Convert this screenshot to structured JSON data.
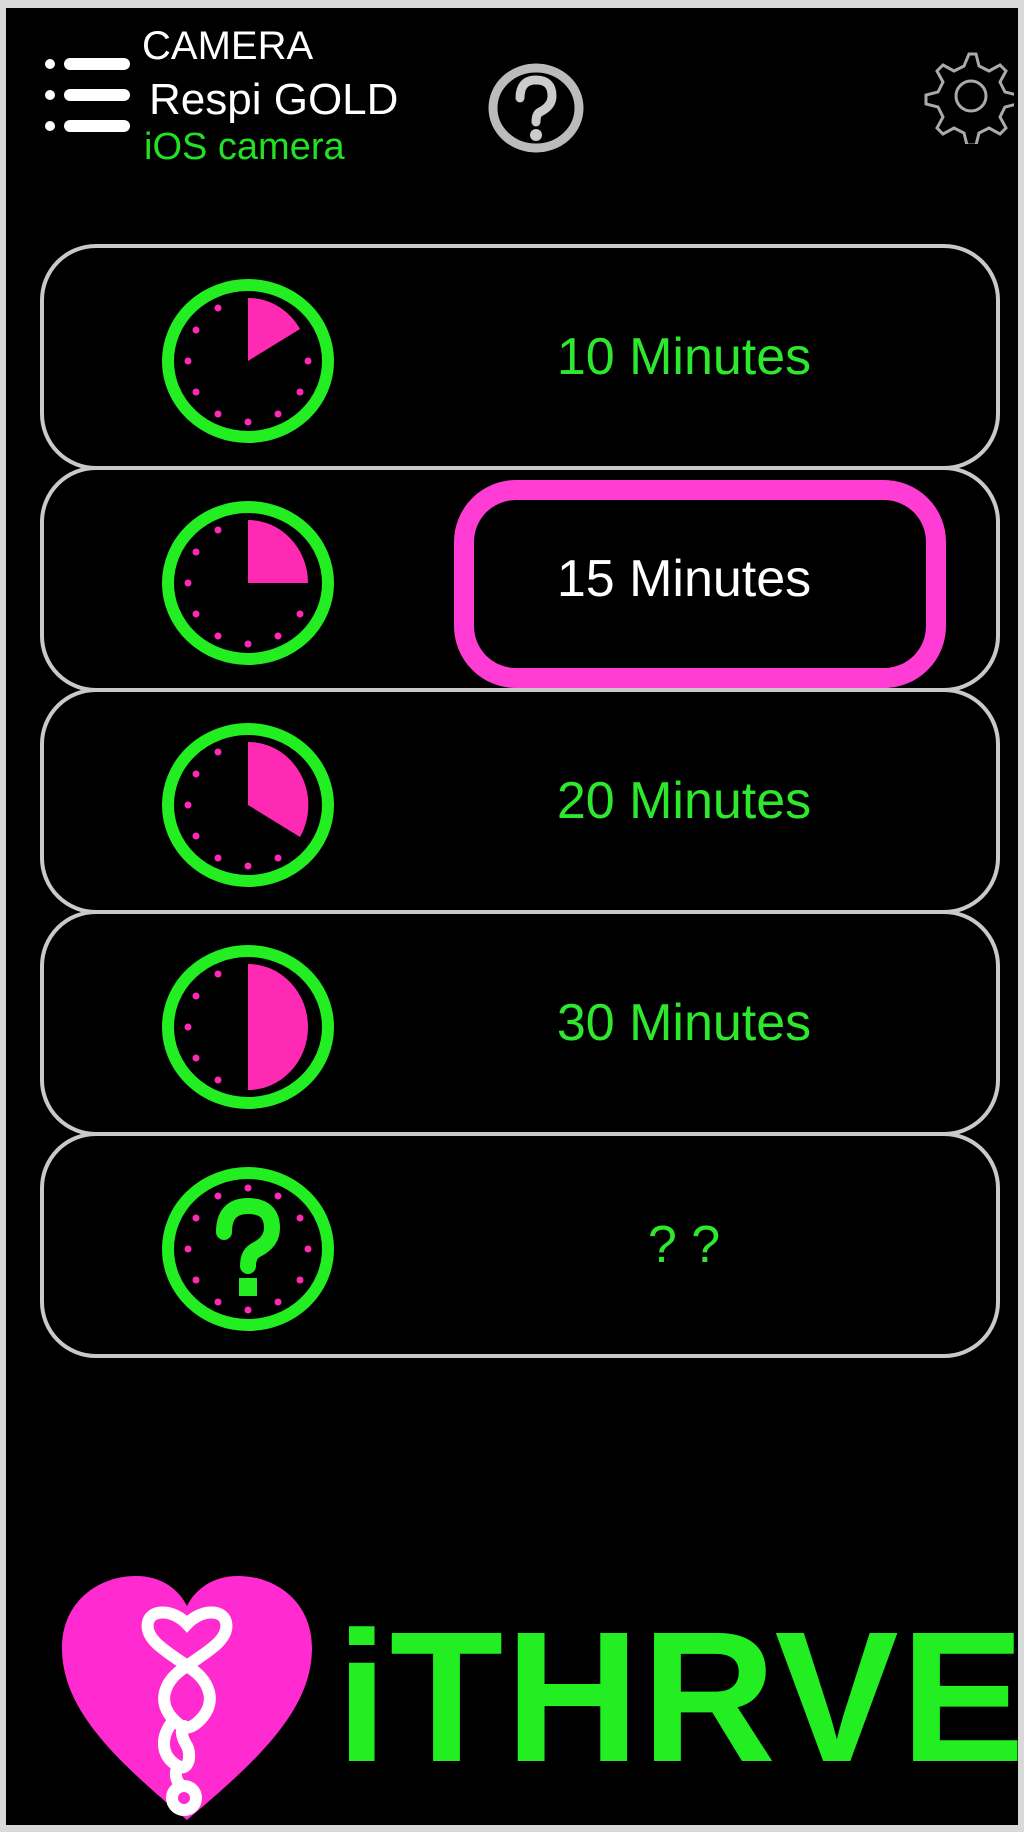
{
  "header": {
    "camera_label": "CAMERA",
    "app_title": "Respi GOLD",
    "camera_source": "iOS camera"
  },
  "options": [
    {
      "label": "10 Minutes",
      "minutes": 10,
      "selected": false
    },
    {
      "label": "15 Minutes",
      "minutes": 15,
      "selected": true
    },
    {
      "label": "20 Minutes",
      "minutes": 20,
      "selected": false
    },
    {
      "label": "30 Minutes",
      "minutes": 30,
      "selected": false
    },
    {
      "label": "? ?",
      "minutes": null,
      "selected": false
    }
  ],
  "logo": {
    "text": "iTHRVE"
  },
  "colors": {
    "accent_green": "#2ee82e",
    "accent_pink": "#ff3dd5",
    "background": "#000000",
    "row_border": "#c9c9c9"
  },
  "icons": [
    "menu-icon",
    "help-icon",
    "gear-icon",
    "clock-icon",
    "question-clock-icon",
    "heart-logo-icon"
  ]
}
